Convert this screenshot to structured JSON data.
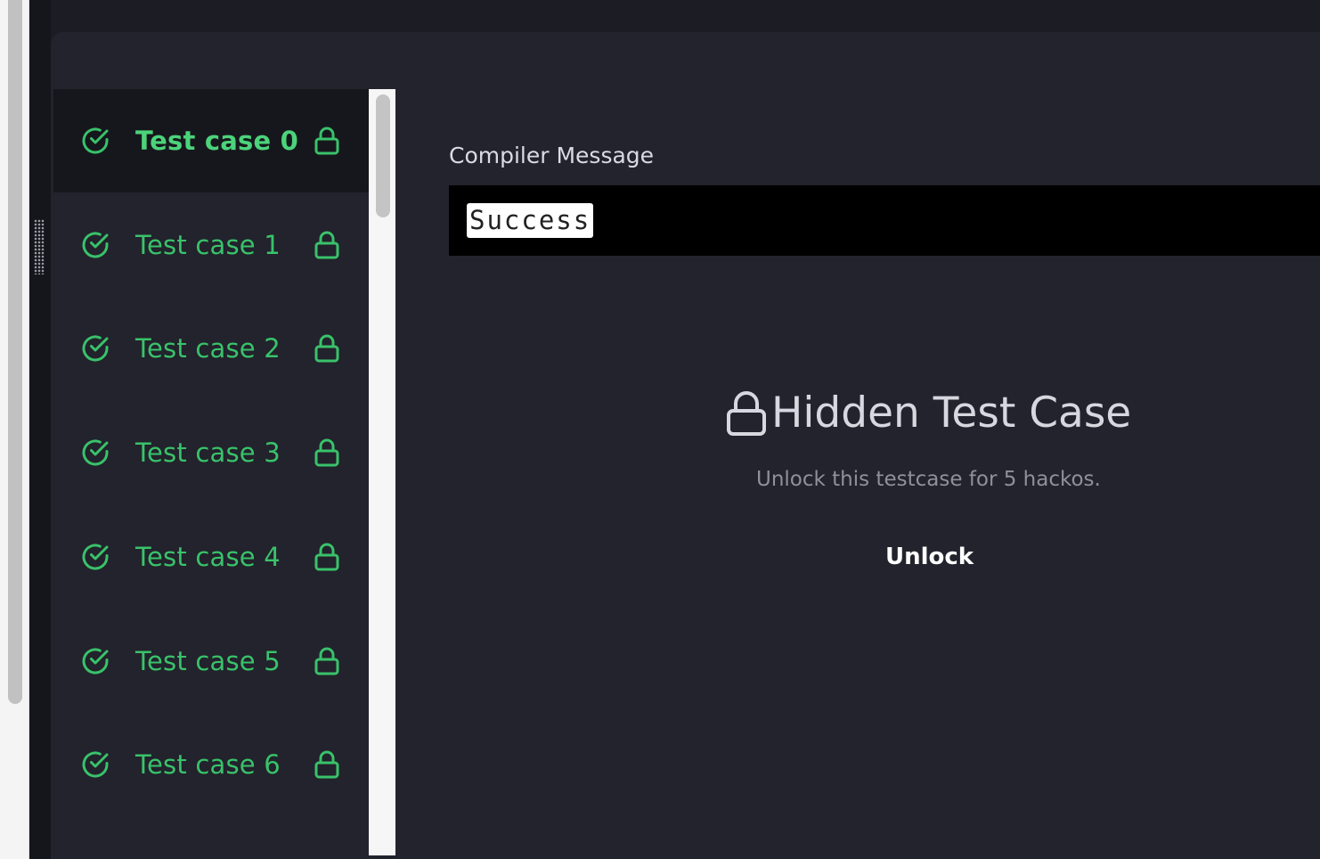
{
  "test_cases": [
    {
      "label": "Test case 0",
      "status": "passed",
      "locked": true,
      "active": true
    },
    {
      "label": "Test case 1",
      "status": "passed",
      "locked": true,
      "active": false
    },
    {
      "label": "Test case 2",
      "status": "passed",
      "locked": true,
      "active": false
    },
    {
      "label": "Test case 3",
      "status": "passed",
      "locked": true,
      "active": false
    },
    {
      "label": "Test case 4",
      "status": "passed",
      "locked": true,
      "active": false
    },
    {
      "label": "Test case 5",
      "status": "passed",
      "locked": true,
      "active": false
    },
    {
      "label": "Test case 6",
      "status": "passed",
      "locked": true,
      "active": false
    }
  ],
  "compiler": {
    "title": "Compiler Message",
    "message": "Success"
  },
  "hidden": {
    "title": "Hidden Test Case",
    "description": "Unlock this testcase for 5 hackos.",
    "button_label": "Unlock"
  },
  "colors": {
    "accent_green": "#39c26a",
    "panel_bg": "#22232c",
    "active_item_bg": "#16171d"
  },
  "icons": {
    "status": "check-circle-icon",
    "lock": "lock-icon"
  }
}
